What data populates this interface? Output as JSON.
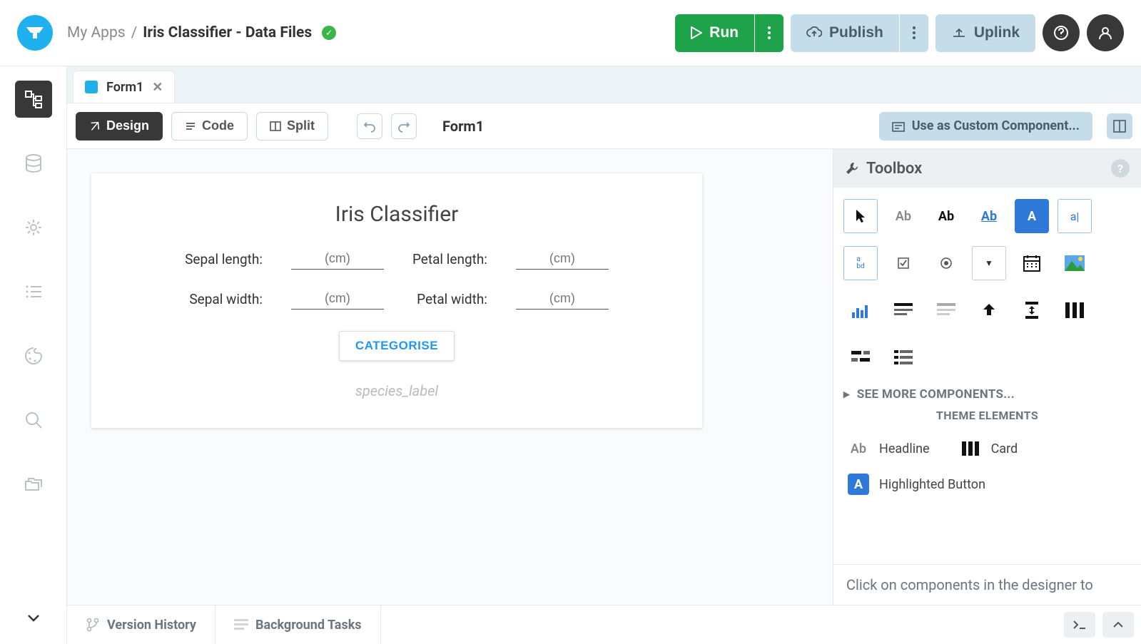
{
  "breadcrumb": {
    "root": "My Apps",
    "sep": "/",
    "leaf": "Iris Classifier - Data Files"
  },
  "header": {
    "run": "Run",
    "publish": "Publish",
    "uplink": "Uplink"
  },
  "tab": {
    "name": "Form1"
  },
  "toolbar": {
    "design": "Design",
    "code": "Code",
    "split": "Split",
    "form_name": "Form1",
    "custom_component": "Use as Custom Component..."
  },
  "form": {
    "title": "Iris Classifier",
    "labels": {
      "sepal_length": "Sepal length:",
      "sepal_width": "Sepal width:",
      "petal_length": "Petal length:",
      "petal_width": "Petal width:"
    },
    "placeholder": "(cm)",
    "button": "CATEGORISE",
    "species_label": "species_label"
  },
  "toolbox": {
    "title": "Toolbox",
    "see_more": "SEE MORE COMPONENTS...",
    "theme_heading": "THEME ELEMENTS",
    "theme": {
      "headline": "Headline",
      "card": "Card",
      "highlighted_button": "Highlighted Button"
    },
    "hint": "Click on components in the designer to"
  },
  "footer": {
    "version_history": "Version History",
    "background_tasks": "Background Tasks"
  }
}
